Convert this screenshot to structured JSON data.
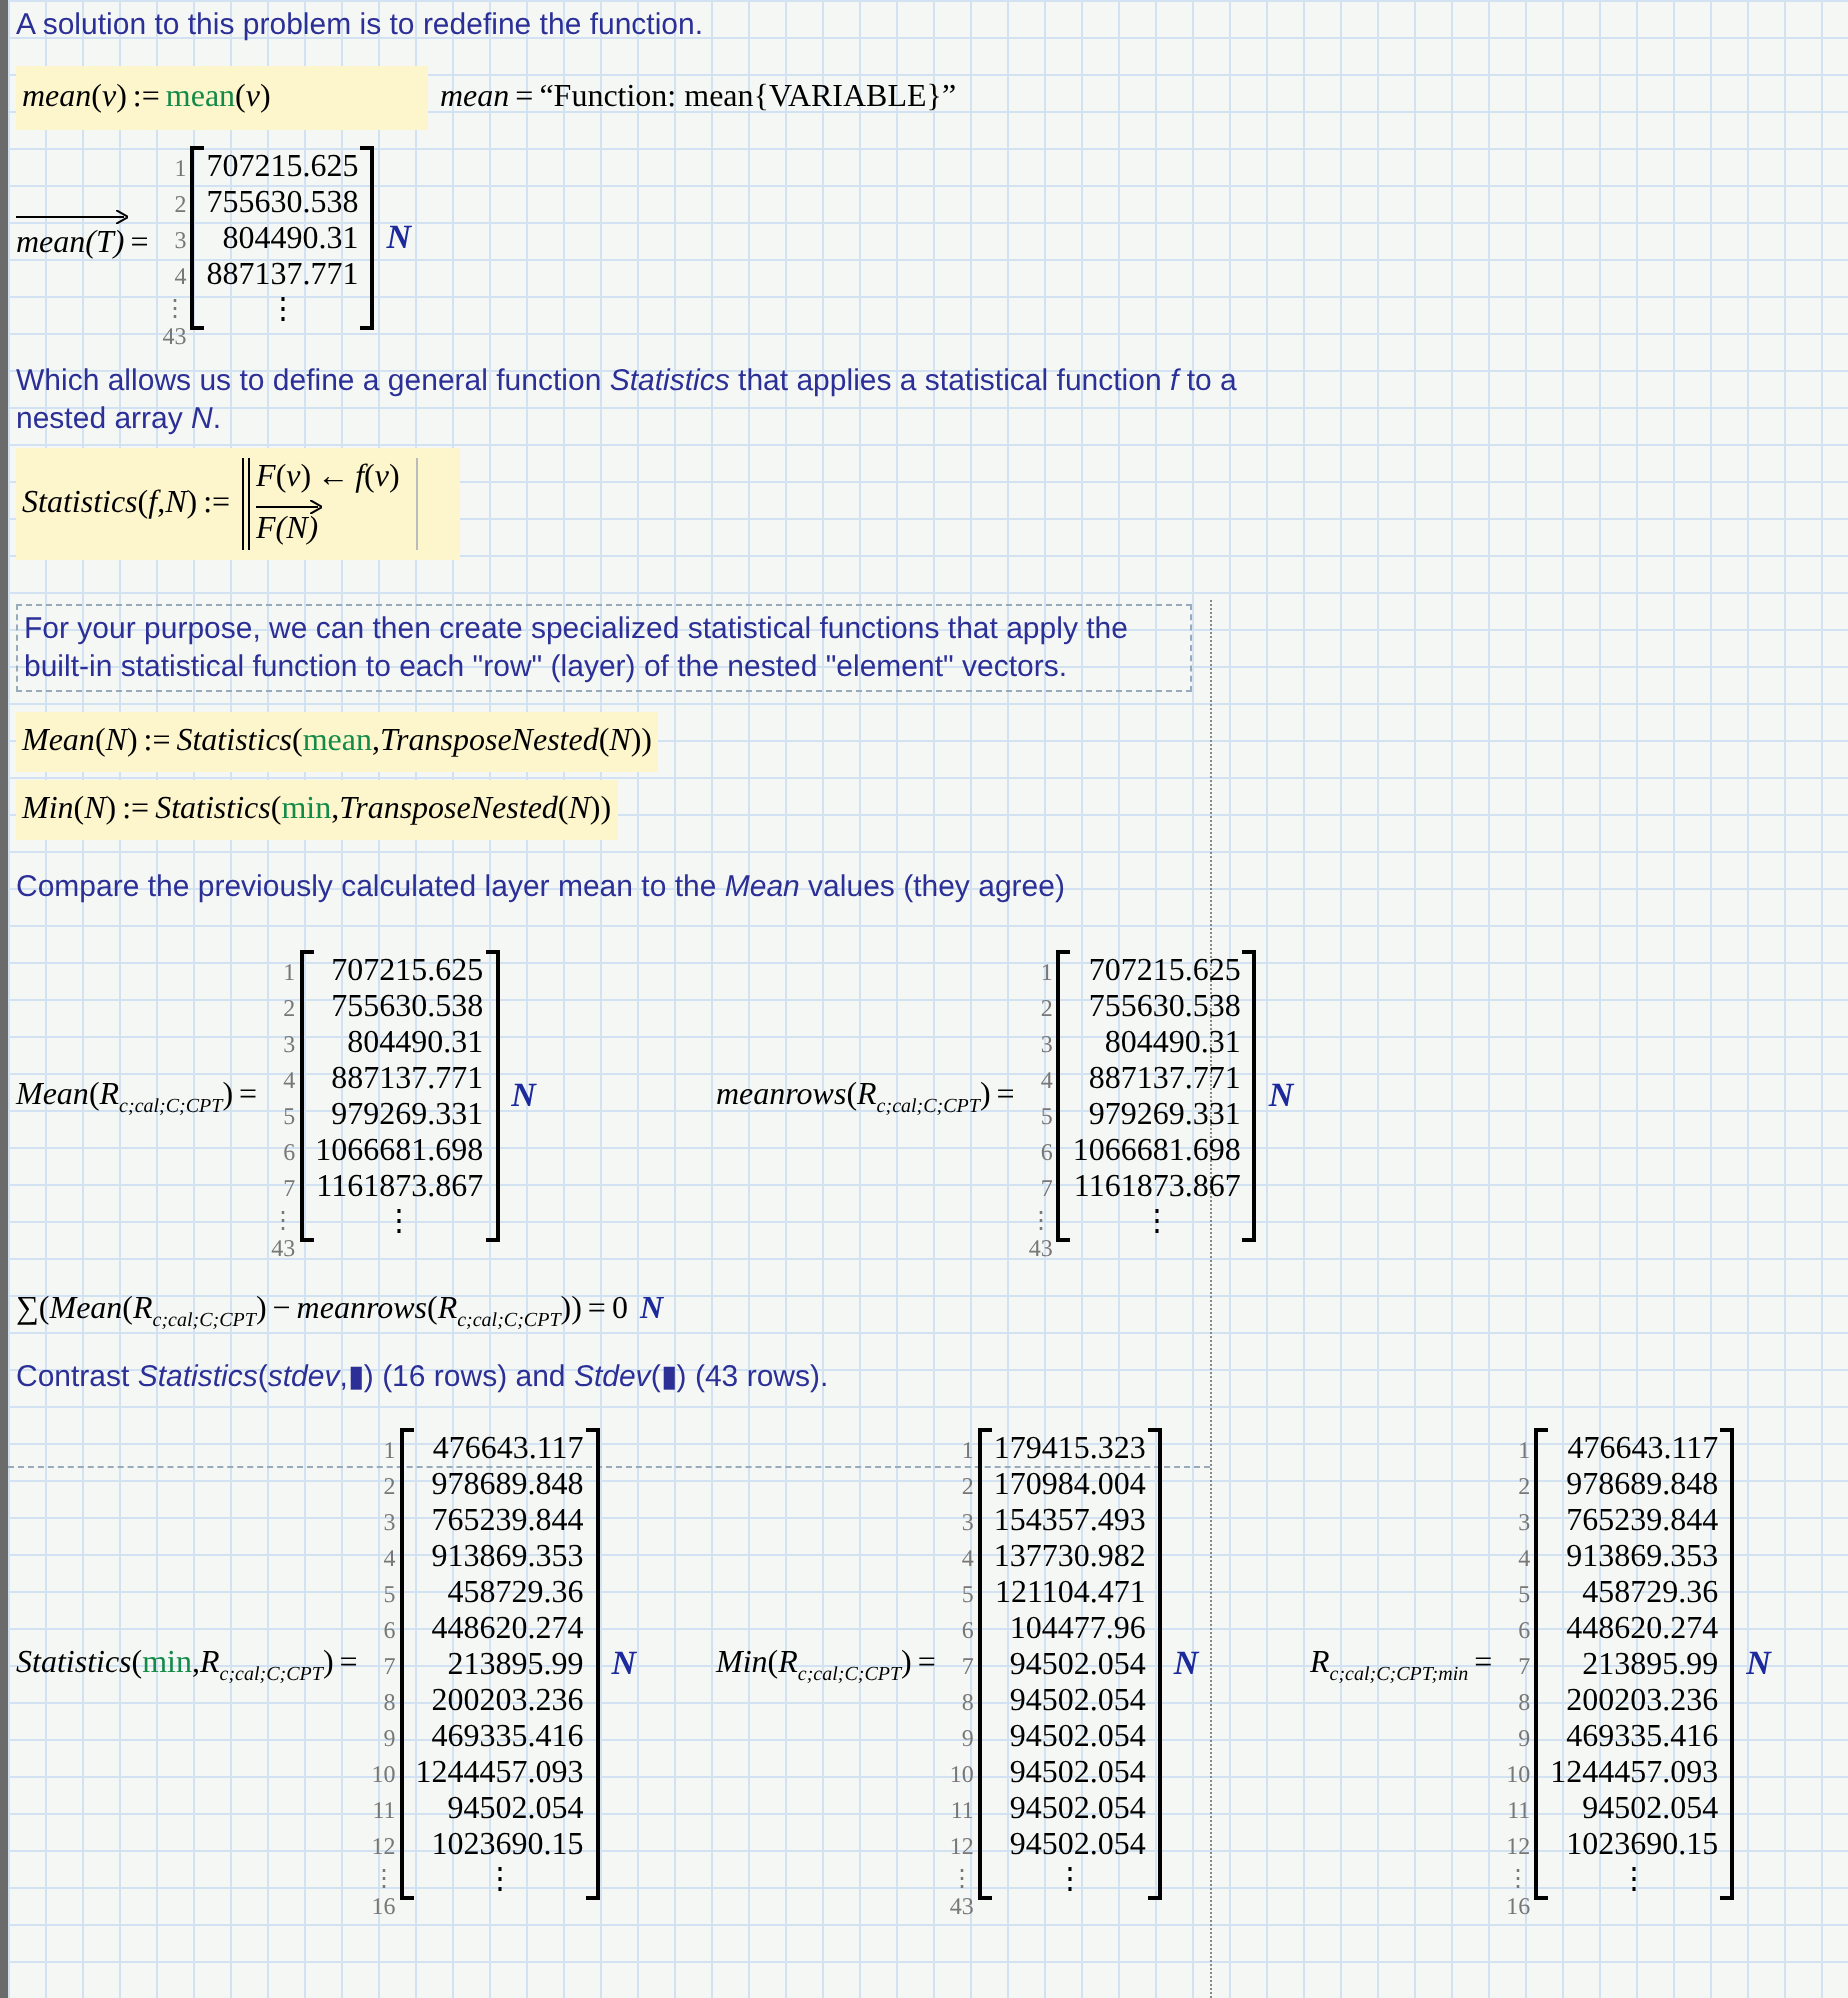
{
  "intro": "A solution to this problem is to redefine the function.",
  "mean_definition": [
    {
      "kind": "v",
      "text": "mean"
    },
    {
      "kind": "s",
      "text": "("
    },
    {
      "kind": "v",
      "text": "v"
    },
    {
      "kind": "s",
      "text": ")"
    },
    {
      "kind": "op",
      "text": ":="
    },
    {
      "kind": "f",
      "text": "mean"
    },
    {
      "kind": "s",
      "text": "("
    },
    {
      "kind": "v",
      "text": "v"
    },
    {
      "kind": "s",
      "text": ")"
    }
  ],
  "mean_display": [
    {
      "kind": "v",
      "text": "mean"
    },
    {
      "kind": "op",
      "text": "="
    },
    {
      "kind": "str",
      "text": "“Function: mean{VARIABLE}”"
    }
  ],
  "mean_vector": {
    "lhs": [
      {
        "kind": "vec",
        "text": "mean(T)"
      },
      {
        "kind": "op",
        "text": "="
      }
    ],
    "matrix": {
      "rows": [
        {
          "index": "1",
          "value": "707215.625"
        },
        {
          "index": "2",
          "value": "755630.538"
        },
        {
          "index": "3",
          "value": "804490.31"
        },
        {
          "index": "4",
          "value": "887137.771"
        }
      ],
      "index_dots": "⋮",
      "value_dots": "⋮",
      "last_index": "43",
      "unit": "N"
    }
  },
  "paragraph_1": "Which allows us to define a general function *Statistics* that applies a statistical function *f* to a nested array *N*.",
  "statistics_definition": {
    "lhs": [
      {
        "kind": "v",
        "text": "Statistics"
      },
      {
        "kind": "s",
        "text": "("
      },
      {
        "kind": "v",
        "text": "f"
      },
      {
        "kind": "s",
        "text": ","
      },
      {
        "kind": "v",
        "text": "N"
      },
      {
        "kind": "s",
        "text": ")"
      },
      {
        "kind": "op",
        "text": ":="
      }
    ],
    "program": [
      [
        {
          "kind": "v",
          "text": "F"
        },
        {
          "kind": "s",
          "text": "("
        },
        {
          "kind": "v",
          "text": "v"
        },
        {
          "kind": "s",
          "text": ")"
        },
        {
          "kind": "op",
          "text": "←"
        },
        {
          "kind": "v",
          "text": "f"
        },
        {
          "kind": "s",
          "text": "("
        },
        {
          "kind": "v",
          "text": "v"
        },
        {
          "kind": "s",
          "text": ")"
        }
      ],
      [
        {
          "kind": "vec",
          "text": "F(N)"
        }
      ]
    ]
  },
  "paragraph_2": "For your purpose, we can then create specialized statistical functions that apply the built-in statistical function to each \"row\" (layer) of the nested \"element\" vectors.",
  "mean_function": [
    {
      "kind": "v",
      "text": "Mean"
    },
    {
      "kind": "s",
      "text": "("
    },
    {
      "kind": "v",
      "text": "N"
    },
    {
      "kind": "s",
      "text": ")"
    },
    {
      "kind": "op",
      "text": ":="
    },
    {
      "kind": "v",
      "text": "Statistics"
    },
    {
      "kind": "s",
      "text": "("
    },
    {
      "kind": "f",
      "text": "mean"
    },
    {
      "kind": "s",
      "text": ","
    },
    {
      "kind": "v",
      "text": "TransposeNested"
    },
    {
      "kind": "s",
      "text": "("
    },
    {
      "kind": "v",
      "text": "N"
    },
    {
      "kind": "s",
      "text": "))"
    }
  ],
  "min_function": [
    {
      "kind": "v",
      "text": "Min"
    },
    {
      "kind": "s",
      "text": "("
    },
    {
      "kind": "v",
      "text": "N"
    },
    {
      "kind": "s",
      "text": ")"
    },
    {
      "kind": "op",
      "text": ":="
    },
    {
      "kind": "v",
      "text": "Statistics"
    },
    {
      "kind": "s",
      "text": "("
    },
    {
      "kind": "f",
      "text": "min"
    },
    {
      "kind": "s",
      "text": ","
    },
    {
      "kind": "v",
      "text": "TransposeNested"
    },
    {
      "kind": "s",
      "text": "("
    },
    {
      "kind": "v",
      "text": "N"
    },
    {
      "kind": "s",
      "text": "))"
    }
  ],
  "paragraph_3": "Compare the previously calculated layer mean to the *Mean* values (they agree)",
  "comparison": [
    {
      "lhs": [
        {
          "kind": "v",
          "text": "Mean"
        },
        {
          "kind": "s",
          "text": "("
        },
        {
          "kind": "v",
          "text": "R"
        },
        {
          "kind": "sub",
          "text": "c;cal;C;CPT"
        },
        {
          "kind": "s",
          "text": ")"
        },
        {
          "kind": "op",
          "text": "="
        }
      ],
      "matrix": {
        "rows": [
          {
            "index": "1",
            "value": "707215.625"
          },
          {
            "index": "2",
            "value": "755630.538"
          },
          {
            "index": "3",
            "value": "804490.31"
          },
          {
            "index": "4",
            "value": "887137.771"
          },
          {
            "index": "5",
            "value": "979269.331"
          },
          {
            "index": "6",
            "value": "1066681.698"
          },
          {
            "index": "7",
            "value": "1161873.867"
          }
        ],
        "index_dots": "⋮",
        "value_dots": "⋮",
        "last_index": "43",
        "unit": "N"
      }
    },
    {
      "lhs": [
        {
          "kind": "v",
          "text": "meanrows"
        },
        {
          "kind": "s",
          "text": "("
        },
        {
          "kind": "v",
          "text": "R"
        },
        {
          "kind": "sub",
          "text": "c;cal;C;CPT"
        },
        {
          "kind": "s",
          "text": ")"
        },
        {
          "kind": "op",
          "text": "="
        }
      ],
      "matrix": {
        "rows": [
          {
            "index": "1",
            "value": "707215.625"
          },
          {
            "index": "2",
            "value": "755630.538"
          },
          {
            "index": "3",
            "value": "804490.31"
          },
          {
            "index": "4",
            "value": "887137.771"
          },
          {
            "index": "5",
            "value": "979269.331"
          },
          {
            "index": "6",
            "value": "1066681.698"
          },
          {
            "index": "7",
            "value": "1161873.867"
          }
        ],
        "index_dots": "⋮",
        "value_dots": "⋮",
        "last_index": "43",
        "unit": "N"
      }
    }
  ],
  "sum_check": [
    {
      "kind": "s",
      "text": "∑"
    },
    {
      "kind": "s",
      "text": "("
    },
    {
      "kind": "v",
      "text": "Mean"
    },
    {
      "kind": "s",
      "text": "("
    },
    {
      "kind": "v",
      "text": "R"
    },
    {
      "kind": "sub",
      "text": "c;cal;C;CPT"
    },
    {
      "kind": "s",
      "text": ")"
    },
    {
      "kind": "op",
      "text": "−"
    },
    {
      "kind": "v",
      "text": "meanrows"
    },
    {
      "kind": "s",
      "text": "("
    },
    {
      "kind": "v",
      "text": "R"
    },
    {
      "kind": "sub",
      "text": "c;cal;C;CPT"
    },
    {
      "kind": "s",
      "text": "))"
    },
    {
      "kind": "op",
      "text": "="
    },
    {
      "kind": "s",
      "text": "0"
    },
    {
      "kind": "u",
      "text": "N"
    }
  ],
  "paragraph_4": "Contrast *Statistics*(*stdev*,▮) (16 rows) and *Stdev*(▮) (43 rows).",
  "results": [
    {
      "lhs": [
        {
          "kind": "v",
          "text": "Statistics"
        },
        {
          "kind": "s",
          "text": "("
        },
        {
          "kind": "f",
          "text": "min"
        },
        {
          "kind": "s",
          "text": ","
        },
        {
          "kind": "v",
          "text": "R"
        },
        {
          "kind": "sub",
          "text": "c;cal;C;CPT"
        },
        {
          "kind": "s",
          "text": ")"
        },
        {
          "kind": "op",
          "text": "="
        }
      ],
      "matrix": {
        "rows": [
          {
            "index": "1",
            "value": "476643.117"
          },
          {
            "index": "2",
            "value": "978689.848"
          },
          {
            "index": "3",
            "value": "765239.844"
          },
          {
            "index": "4",
            "value": "913869.353"
          },
          {
            "index": "5",
            "value": "458729.36"
          },
          {
            "index": "6",
            "value": "448620.274"
          },
          {
            "index": "7",
            "value": "213895.99"
          },
          {
            "index": "8",
            "value": "200203.236"
          },
          {
            "index": "9",
            "value": "469335.416"
          },
          {
            "index": "10",
            "value": "1244457.093"
          },
          {
            "index": "11",
            "value": "94502.054"
          },
          {
            "index": "12",
            "value": "1023690.15"
          }
        ],
        "index_dots": "⋮",
        "value_dots": "⋮",
        "last_index": "16",
        "unit": "N"
      }
    },
    {
      "lhs": [
        {
          "kind": "v",
          "text": "Min"
        },
        {
          "kind": "s",
          "text": "("
        },
        {
          "kind": "v",
          "text": "R"
        },
        {
          "kind": "sub",
          "text": "c;cal;C;CPT"
        },
        {
          "kind": "s",
          "text": ")"
        },
        {
          "kind": "op",
          "text": "="
        }
      ],
      "matrix": {
        "rows": [
          {
            "index": "1",
            "value": "179415.323"
          },
          {
            "index": "2",
            "value": "170984.004"
          },
          {
            "index": "3",
            "value": "154357.493"
          },
          {
            "index": "4",
            "value": "137730.982"
          },
          {
            "index": "5",
            "value": "121104.471"
          },
          {
            "index": "6",
            "value": "104477.96"
          },
          {
            "index": "7",
            "value": "94502.054"
          },
          {
            "index": "8",
            "value": "94502.054"
          },
          {
            "index": "9",
            "value": "94502.054"
          },
          {
            "index": "10",
            "value": "94502.054"
          },
          {
            "index": "11",
            "value": "94502.054"
          },
          {
            "index": "12",
            "value": "94502.054"
          }
        ],
        "index_dots": "⋮",
        "value_dots": "⋮",
        "last_index": "43",
        "unit": "N"
      }
    },
    {
      "lhs": [
        {
          "kind": "v",
          "text": "R"
        },
        {
          "kind": "sub",
          "text": "c;cal;C;CPT;min"
        },
        {
          "kind": "op",
          "text": "="
        }
      ],
      "matrix": {
        "rows": [
          {
            "index": "1",
            "value": "476643.117"
          },
          {
            "index": "2",
            "value": "978689.848"
          },
          {
            "index": "3",
            "value": "765239.844"
          },
          {
            "index": "4",
            "value": "913869.353"
          },
          {
            "index": "5",
            "value": "458729.36"
          },
          {
            "index": "6",
            "value": "448620.274"
          },
          {
            "index": "7",
            "value": "213895.99"
          },
          {
            "index": "8",
            "value": "200203.236"
          },
          {
            "index": "9",
            "value": "469335.416"
          },
          {
            "index": "10",
            "value": "1244457.093"
          },
          {
            "index": "11",
            "value": "94502.054"
          },
          {
            "index": "12",
            "value": "1023690.15"
          }
        ],
        "index_dots": "⋮",
        "value_dots": "⋮",
        "last_index": "16",
        "unit": "N"
      }
    }
  ]
}
